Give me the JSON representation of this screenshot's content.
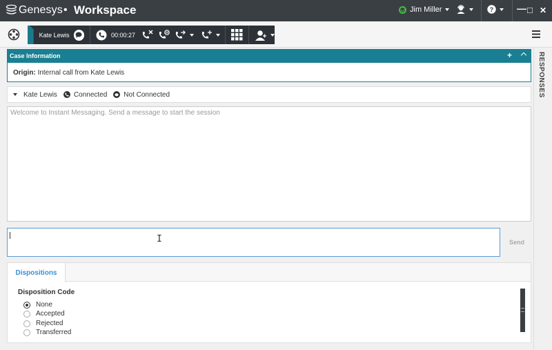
{
  "titlebar": {
    "brand": "Genesys",
    "separator": "•",
    "app": "Workspace",
    "user": "Jim Miller",
    "window_controls": {
      "minimize": "—",
      "maximize": "□",
      "close": "✕"
    }
  },
  "toolbar": {
    "contact_name": "Kate Lewis",
    "timer": "00:00:27"
  },
  "responses": {
    "label": "RESPONSES"
  },
  "case": {
    "title": "Case Information",
    "plus": "+",
    "origin_label": "Origin:",
    "origin_value": "Internal call from Kate Lewis"
  },
  "party": {
    "name": "Kate Lewis",
    "status_connected": "Connected",
    "status_not_connected": "Not Connected"
  },
  "transcript": {
    "welcome": "Welcome to Instant Messaging. Send a message to start the session"
  },
  "compose": {
    "send_label": "Send"
  },
  "dispositions": {
    "tab_label": "Dispositions",
    "code_label": "Disposition Code",
    "options": [
      {
        "label": "None",
        "selected": true
      },
      {
        "label": "Accepted",
        "selected": false
      },
      {
        "label": "Rejected",
        "selected": false
      },
      {
        "label": "Transferred",
        "selected": false
      }
    ]
  },
  "colors": {
    "titlebar_bg": "#3a3f44",
    "accent_teal": "#1a7f92",
    "link_blue": "#3a8fd0",
    "status_green": "#3ec23e"
  }
}
